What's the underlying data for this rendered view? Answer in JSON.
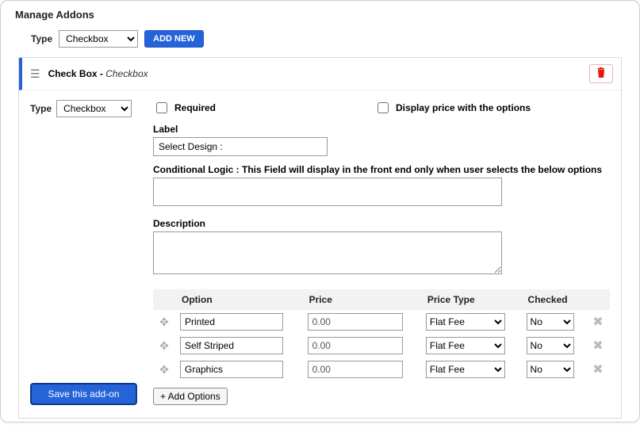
{
  "header": {
    "title": "Manage Addons"
  },
  "toprow": {
    "type_label": "Type",
    "type_value": "Checkbox",
    "addnew_label": "ADD NEW"
  },
  "card": {
    "title_prefix": "Check Box - ",
    "title_suffix": "Checkbox"
  },
  "left": {
    "type_label": "Type",
    "type_value": "Checkbox",
    "save_label": "Save this add-on"
  },
  "checks": {
    "required_label": "Required",
    "display_price_label": "Display price with the options"
  },
  "fields": {
    "label_label": "Label",
    "label_value": "Select Design :",
    "logic_label": "Conditional Logic : This Field will display in the front end only when user selects the below options",
    "logic_value": "",
    "desc_label": "Description",
    "desc_value": ""
  },
  "table": {
    "headers": {
      "option": "Option",
      "price": "Price",
      "pricetype": "Price Type",
      "checked": "Checked"
    },
    "rows": [
      {
        "option": "Printed",
        "price": "0.00",
        "pricetype": "Flat Fee",
        "checked": "No"
      },
      {
        "option": "Self Striped",
        "price": "0.00",
        "pricetype": "Flat Fee",
        "checked": "No"
      },
      {
        "option": "Graphics",
        "price": "0.00",
        "pricetype": "Flat Fee",
        "checked": "No"
      }
    ],
    "addopt_label": "+ Add Options"
  }
}
